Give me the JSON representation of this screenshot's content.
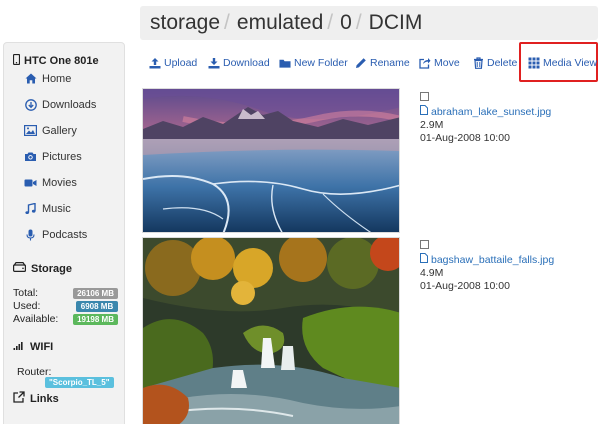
{
  "breadcrumb": {
    "parts": [
      "storage",
      "emulated",
      "0",
      "DCIM"
    ],
    "separator": "/"
  },
  "sidebar": {
    "device": "HTC One 801e",
    "nav": [
      {
        "label": "Home",
        "icon": "home-icon"
      },
      {
        "label": "Downloads",
        "icon": "download-circle-icon"
      },
      {
        "label": "Gallery",
        "icon": "image-icon"
      },
      {
        "label": "Pictures",
        "icon": "camera-icon"
      },
      {
        "label": "Movies",
        "icon": "video-camera-icon"
      },
      {
        "label": "Music",
        "icon": "music-icon"
      },
      {
        "label": "Podcasts",
        "icon": "microphone-icon"
      }
    ],
    "storage": {
      "title": "Storage",
      "rows": [
        {
          "label": "Total:",
          "value": "26106 MB",
          "color": "#999999"
        },
        {
          "label": "Used:",
          "value": "6908 MB",
          "color": "#3a87ad"
        },
        {
          "label": "Available:",
          "value": "19198 MB",
          "color": "#5cb85c"
        }
      ]
    },
    "wifi": {
      "title": "WIFI",
      "router_label": "Router:",
      "router_value": "\"Scorpio_TL_5\""
    },
    "links": {
      "title": "Links"
    }
  },
  "toolbar": {
    "upload": "Upload",
    "download": "Download",
    "new_folder": "New Folder",
    "rename": "Rename",
    "move": "Move",
    "delete": "Delete",
    "media_view": "Media View"
  },
  "files": [
    {
      "name": "abraham_lake_sunset.jpg",
      "size": "2.9M",
      "date": "01-Aug-2008 10:00"
    },
    {
      "name": "bagshaw_battaile_falls.jpg",
      "size": "4.9M",
      "date": "01-Aug-2008 10:00"
    }
  ],
  "colors": {
    "link": "#2a5db0",
    "highlight": "#e02020",
    "router_badge": "#5bc0de"
  }
}
